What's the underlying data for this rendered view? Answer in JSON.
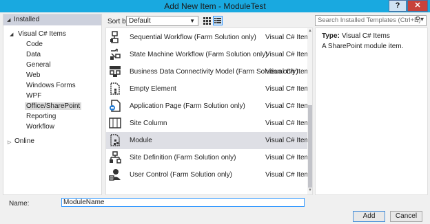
{
  "window": {
    "title": "Add New Item - ModuleTest",
    "help_label": "?",
    "close_label": "✕"
  },
  "left_pane": {
    "installed_label": "Installed",
    "category_label": "Visual C# Items",
    "items": [
      {
        "label": "Code"
      },
      {
        "label": "Data"
      },
      {
        "label": "General"
      },
      {
        "label": "Web"
      },
      {
        "label": "Windows Forms"
      },
      {
        "label": "WPF"
      },
      {
        "label": "Office/SharePoint",
        "selected": true
      },
      {
        "label": "Reporting"
      },
      {
        "label": "Workflow"
      }
    ],
    "online_label": "Online"
  },
  "toolbar": {
    "sort_label": "Sort by:",
    "sort_value": "Default",
    "search_placeholder": "Search Installed Templates (Ctrl+E)"
  },
  "templates": [
    {
      "name": "Sequential Workflow (Farm Solution only)",
      "language": "Visual C# Items",
      "icon": "sequential-workflow-icon"
    },
    {
      "name": "State Machine Workflow (Farm Solution only)",
      "language": "Visual C# Items",
      "icon": "state-machine-workflow-icon"
    },
    {
      "name": "Business Data Connectivity Model (Farm Solution only)",
      "language": "Visual C# Items",
      "icon": "bdc-model-icon"
    },
    {
      "name": "Empty Element",
      "language": "Visual C# Items",
      "icon": "empty-element-icon"
    },
    {
      "name": "Application Page (Farm Solution only)",
      "language": "Visual C# Items",
      "icon": "application-page-icon"
    },
    {
      "name": "Site Column",
      "language": "Visual C# Items",
      "icon": "site-column-icon"
    },
    {
      "name": "Module",
      "language": "Visual C# Items",
      "icon": "module-icon",
      "selected": true
    },
    {
      "name": "Site Definition (Farm Solution only)",
      "language": "Visual C# Items",
      "icon": "site-definition-icon"
    },
    {
      "name": "User Control (Farm Solution only)",
      "language": "Visual C# Items",
      "icon": "user-control-icon"
    }
  ],
  "details": {
    "type_label": "Type:",
    "type_value": "Visual C# Items",
    "description": "A SharePoint module item."
  },
  "footer": {
    "name_label": "Name:",
    "name_value": "ModuleName",
    "add_label": "Add",
    "cancel_label": "Cancel"
  }
}
